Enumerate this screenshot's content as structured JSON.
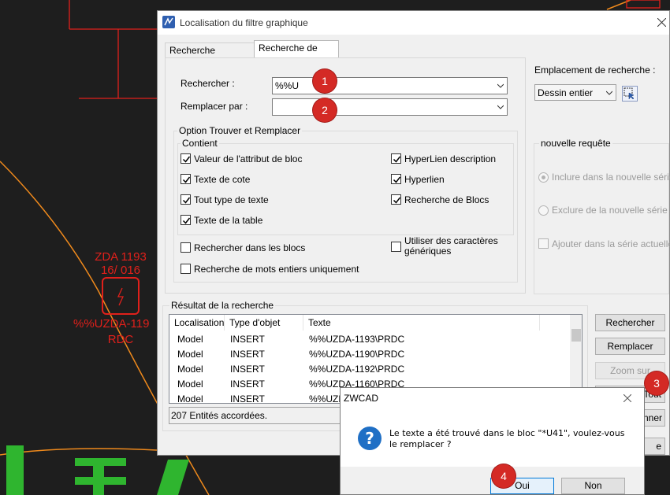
{
  "cad": {
    "block_name": "ZDA 1193",
    "block_number": "16/ 016",
    "block_attr": "%%UZDA-119",
    "block_level": "RDC"
  },
  "dialog": {
    "title": "Localisation du filtre graphique",
    "tabs": [
      {
        "label": "Recherche graphique",
        "active": false
      },
      {
        "label": "Recherche de texte",
        "active": true
      }
    ],
    "search_label": "Rechercher :",
    "search_value": "%%U",
    "replace_label": "Remplacer par :",
    "replace_value": "",
    "options_group": "Option Trouver et Remplacer",
    "contains_group": "Contient",
    "checkboxes": [
      {
        "label": "Valeur de l'attribut de bloc",
        "checked": true
      },
      {
        "label": "Texte de cote",
        "checked": true
      },
      {
        "label": "Tout type de texte",
        "checked": true
      },
      {
        "label": "Texte de la table",
        "checked": true
      },
      {
        "label": "HyperLien description",
        "checked": true
      },
      {
        "label": "Hyperlien",
        "checked": true
      },
      {
        "label": "Recherche de Blocs",
        "checked": true
      },
      {
        "label": "Rechercher dans les blocs",
        "checked": false
      },
      {
        "label": "Recherche de mots entiers uniquement",
        "checked": false
      },
      {
        "label": "Utiliser des caractères génériques",
        "checked": false
      }
    ],
    "location_label": "Emplacement de recherche :",
    "location_value": "Dessin entier",
    "new_query_group": "nouvelle requête",
    "radios": [
      {
        "label": "Inclure dans la nouvelle série",
        "selected": true
      },
      {
        "label": "Exclure de la nouvelle série",
        "selected": false
      }
    ],
    "add_current_label": "Ajouter dans la série  actuelle",
    "results_group": "Résultat de la recherche",
    "columns": [
      "Localisation",
      "Type d'objet",
      "Texte"
    ],
    "rows": [
      [
        "Model",
        "INSERT",
        "%%UZDA-1193\\PRDC"
      ],
      [
        "Model",
        "INSERT",
        "%%UZDA-1190\\PRDC"
      ],
      [
        "Model",
        "INSERT",
        "%%UZDA-1192\\PRDC"
      ],
      [
        "Model",
        "INSERT",
        "%%UZDA-1160\\PRDC"
      ],
      [
        "Model",
        "INSERT",
        "%%UZDA-"
      ]
    ],
    "status": "207 Entités accordées.",
    "buttons": {
      "search": "Rechercher",
      "replace": "Remplacer",
      "zoom": "Zoom sur",
      "replace_all": "r Tout",
      "select": "tionner",
      "close": "e"
    }
  },
  "msgbox": {
    "title": "ZWCAD",
    "message": "Le texte a été trouvé dans le bloc \"*U41\", voulez-vous le remplacer ?",
    "yes": "Oui",
    "no": "Non"
  },
  "badges": [
    "1",
    "2",
    "3",
    "4"
  ],
  "colors": {
    "cad_background": "#1e1e1e",
    "cad_red": "#e0201b",
    "cad_orange": "#f08a1c",
    "cad_green": "#2fb52f",
    "badge_red": "#d42a25"
  }
}
